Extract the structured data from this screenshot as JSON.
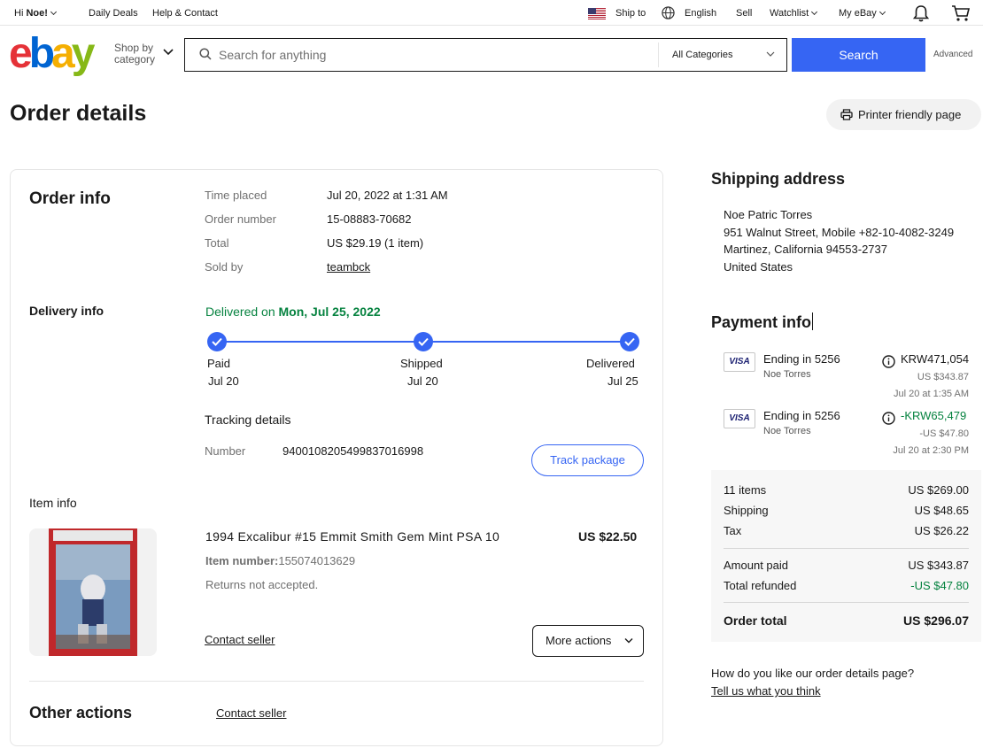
{
  "topbar": {
    "greeting_prefix": "Hi ",
    "greeting_name": "Noe!",
    "daily_deals": "Daily Deals",
    "help_contact": "Help & Contact",
    "ship_to": "Ship to",
    "language": "English",
    "sell": "Sell",
    "watchlist": "Watchlist",
    "my_ebay": "My eBay"
  },
  "header": {
    "logo": {
      "e": "e",
      "b": "b",
      "a": "a",
      "y": "y"
    },
    "shop_by_line1": "Shop by",
    "shop_by_line2": "category",
    "search_placeholder": "Search for anything",
    "category": "All Categories",
    "search_button": "Search",
    "advanced": "Advanced"
  },
  "page": {
    "title": "Order details",
    "printer_friendly": "Printer friendly page"
  },
  "order_info": {
    "title": "Order info",
    "rows": [
      {
        "label": "Time placed",
        "value": "Jul 20, 2022 at 1:31 AM"
      },
      {
        "label": "Order number",
        "value": "15-08883-70682"
      },
      {
        "label": "Total",
        "value": "US $29.19 (1 item)"
      },
      {
        "label": "Sold by",
        "value": "teambck"
      }
    ]
  },
  "delivery_info": {
    "title": "Delivery info",
    "status_prefix": "Delivered on ",
    "status_date": "Mon, Jul 25, 2022",
    "steps": [
      {
        "label": "Paid",
        "date": "Jul 20"
      },
      {
        "label": "Shipped",
        "date": "Jul 20"
      },
      {
        "label": "Delivered",
        "date": "Jul 25"
      }
    ],
    "tracking_title": "Tracking details",
    "number_label": "Number",
    "number_value": "9400108205499837016998",
    "track_button": "Track package"
  },
  "item_info": {
    "title": "Item info",
    "item_title": "1994 Excalibur #15 Emmit Smith Gem Mint PSA 10",
    "price": "US $22.50",
    "item_number_label": "Item number:",
    "item_number": "155074013629",
    "returns": "Returns not accepted.",
    "contact_seller": "Contact seller",
    "more_actions": "More actions"
  },
  "other_actions": {
    "title": "Other actions",
    "contact_seller": "Contact seller"
  },
  "shipping_address": {
    "title": "Shipping address",
    "lines": [
      "Noe Patric Torres",
      "951 Walnut Street, Mobile +82-10-4082-3249",
      "Martinez, California 94553-2737",
      "United States"
    ]
  },
  "payment_info": {
    "title": "Payment info",
    "payments": [
      {
        "card": "VISA",
        "ending": "Ending in 5256",
        "name": "Noe Torres",
        "amount": "KRW471,054",
        "usd": "US $343.87",
        "date": "Jul 20 at 1:35 AM"
      },
      {
        "card": "VISA",
        "ending": "Ending in 5256",
        "name": "Noe Torres",
        "amount": "-KRW65,479",
        "usd": "-US $47.80",
        "date": "Jul 20 at 2:30 PM"
      }
    ]
  },
  "summary": {
    "items_label": "11 items",
    "items_value": "US $269.00",
    "shipping_label": "Shipping",
    "shipping_value": "US $48.65",
    "tax_label": "Tax",
    "tax_value": "US $26.22",
    "paid_label": "Amount paid",
    "paid_value": "US $343.87",
    "refunded_label": "Total refunded",
    "refunded_value": "-US $47.80",
    "total_label": "Order total",
    "total_value": "US $296.07"
  },
  "feedback": {
    "question": "How do you like our order details page?",
    "link": "Tell us what you think"
  },
  "colors": {
    "ebay_red": "#e53238",
    "ebay_blue": "#0064d2",
    "ebay_yellow": "#f5af02",
    "ebay_green": "#86b817",
    "accent_blue": "#3665f3",
    "success_green": "#05823f"
  }
}
